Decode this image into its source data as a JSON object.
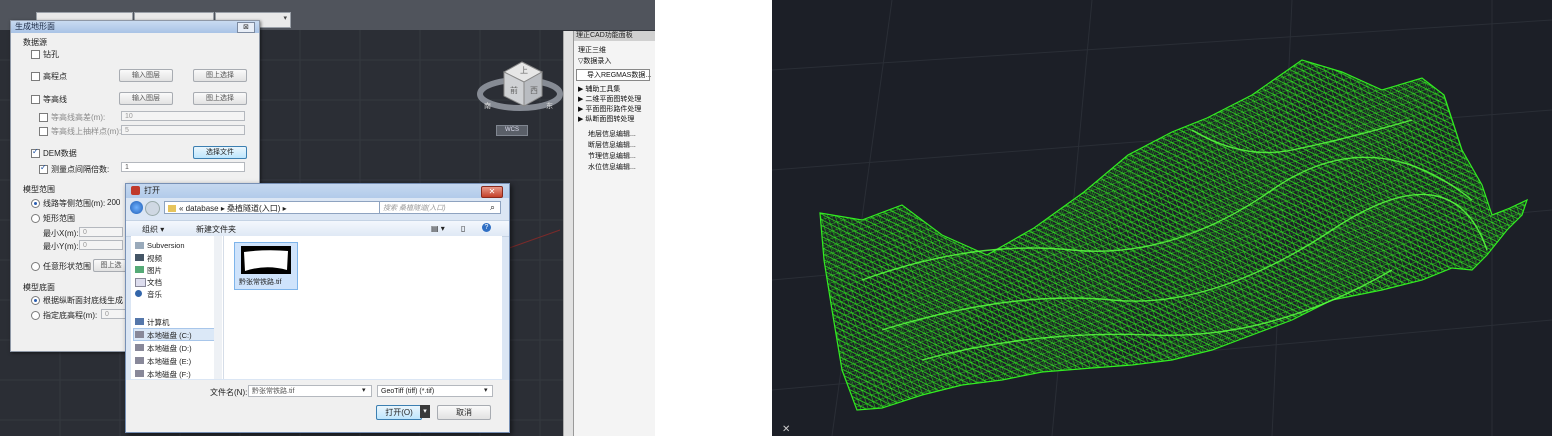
{
  "left_window": {
    "generate_dialog": {
      "title": "生成地形面",
      "close_glyph": "⊠",
      "data_source": {
        "heading": "数据源",
        "borehole": "钻孔",
        "elevation_point": "高程点",
        "contour": "等高线",
        "contour_interval_label": "等高线高差(m):",
        "contour_interval_value": "10",
        "contour_sample_label": "等高线上抽样点(m):",
        "contour_sample_value": "5",
        "dem": "DEM数据",
        "measure_interval_label": "测量点间隔倍数:",
        "measure_interval_value": "1",
        "input_layer": "输入图层",
        "pick_on_map": "图上选择",
        "select_file": "选择文件"
      },
      "model_range": {
        "heading": "模型范围",
        "route_width_label": "线路等侧范围(m):",
        "route_width_value": "200",
        "rect_range": "矩形范围",
        "min_x_label": "最小X(m):",
        "min_x_value": "0",
        "min_y_label": "最小Y(m):",
        "min_y_value": "0",
        "any_shape": "任意形状范围",
        "pick_on_map": "图上选"
      },
      "model_base": {
        "heading": "模型底面",
        "by_profile": "根据纵断面封底线生成",
        "fixed_elev_label": "指定底高程(m):",
        "fixed_elev_value": "0"
      }
    },
    "viewcube": {
      "top": "上",
      "front": "前",
      "right": "西",
      "south": "南",
      "east": "东"
    },
    "wcs_label": "WCS",
    "side_panel": {
      "title": "理正CAD功能面板",
      "items": [
        "理正三维",
        "数据录入",
        "导入REGMAS数据...",
        "辅助工具集",
        "二维平面图转处理",
        "平面图形路件处理",
        "纵断面图转处理",
        "地层信息编辑...",
        "断层信息编辑...",
        "节理信息编辑...",
        "水位信息编辑..."
      ]
    },
    "open_dialog": {
      "title": "打开",
      "address": "« database ▸ 桑植隧道(入口) ▸",
      "search_placeholder": "搜索 桑植隧道(入口)",
      "organize": "组织 ▾",
      "new_folder": "新建文件夹",
      "nav": [
        "Subversion",
        "视频",
        "图片",
        "文档",
        "音乐",
        "计算机",
        "本地磁盘 (C:)",
        "本地磁盘 (D:)",
        "本地磁盘 (E:)",
        "本地磁盘 (F:)"
      ],
      "file_name": "黔张常铁路.tif",
      "filename_label": "文件名(N):",
      "filename_value": "黔张常铁路.tif",
      "filetype_value": "GeoTiff (tiff) (*.tif)",
      "open_button": "打开(O)",
      "cancel_button": "取消"
    }
  }
}
